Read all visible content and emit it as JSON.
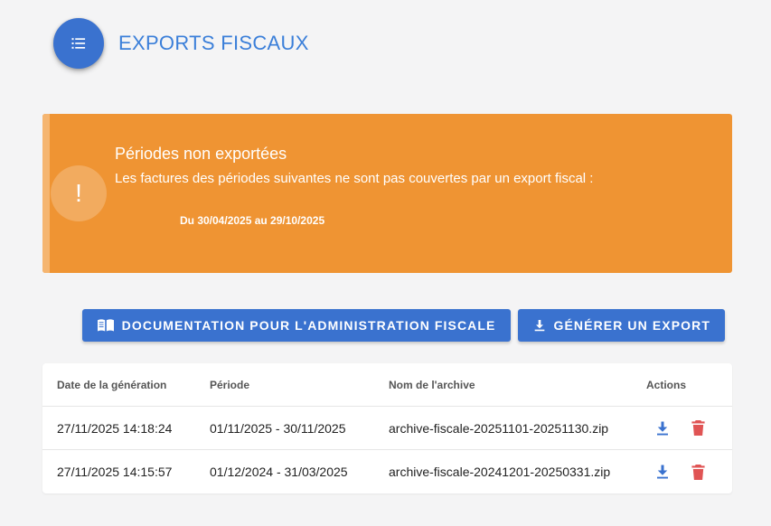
{
  "header": {
    "title": "EXPORTS FISCAUX",
    "menu_icon": "list-icon"
  },
  "alert": {
    "title": "Périodes non exportées",
    "text": "Les factures des périodes suivantes ne sont pas couvertes par un export fiscal :",
    "period": "Du 30/04/2025 au 29/10/2025",
    "icon": "!",
    "color": "#ef9433"
  },
  "toolbar": {
    "doc_label": "Documentation pour l'administration fiscale",
    "doc_icon": "book-open-icon",
    "export_label": "Générer un export",
    "export_icon": "download-icon",
    "accent": "#3a72cf"
  },
  "table": {
    "columns": [
      "Date de la génération",
      "Période",
      "Nom de l'archive",
      "Actions"
    ],
    "rows": [
      {
        "date": "27/11/2025 14:18:24",
        "period": "01/11/2025 - 30/11/2025",
        "archive": "archive-fiscale-20251101-20251130.zip"
      },
      {
        "date": "27/11/2025 14:15:57",
        "period": "01/12/2024 - 31/03/2025",
        "archive": "archive-fiscale-20241201-20250331.zip"
      }
    ],
    "download_icon_color": "#3a72cf",
    "delete_icon_color": "#e05454"
  }
}
